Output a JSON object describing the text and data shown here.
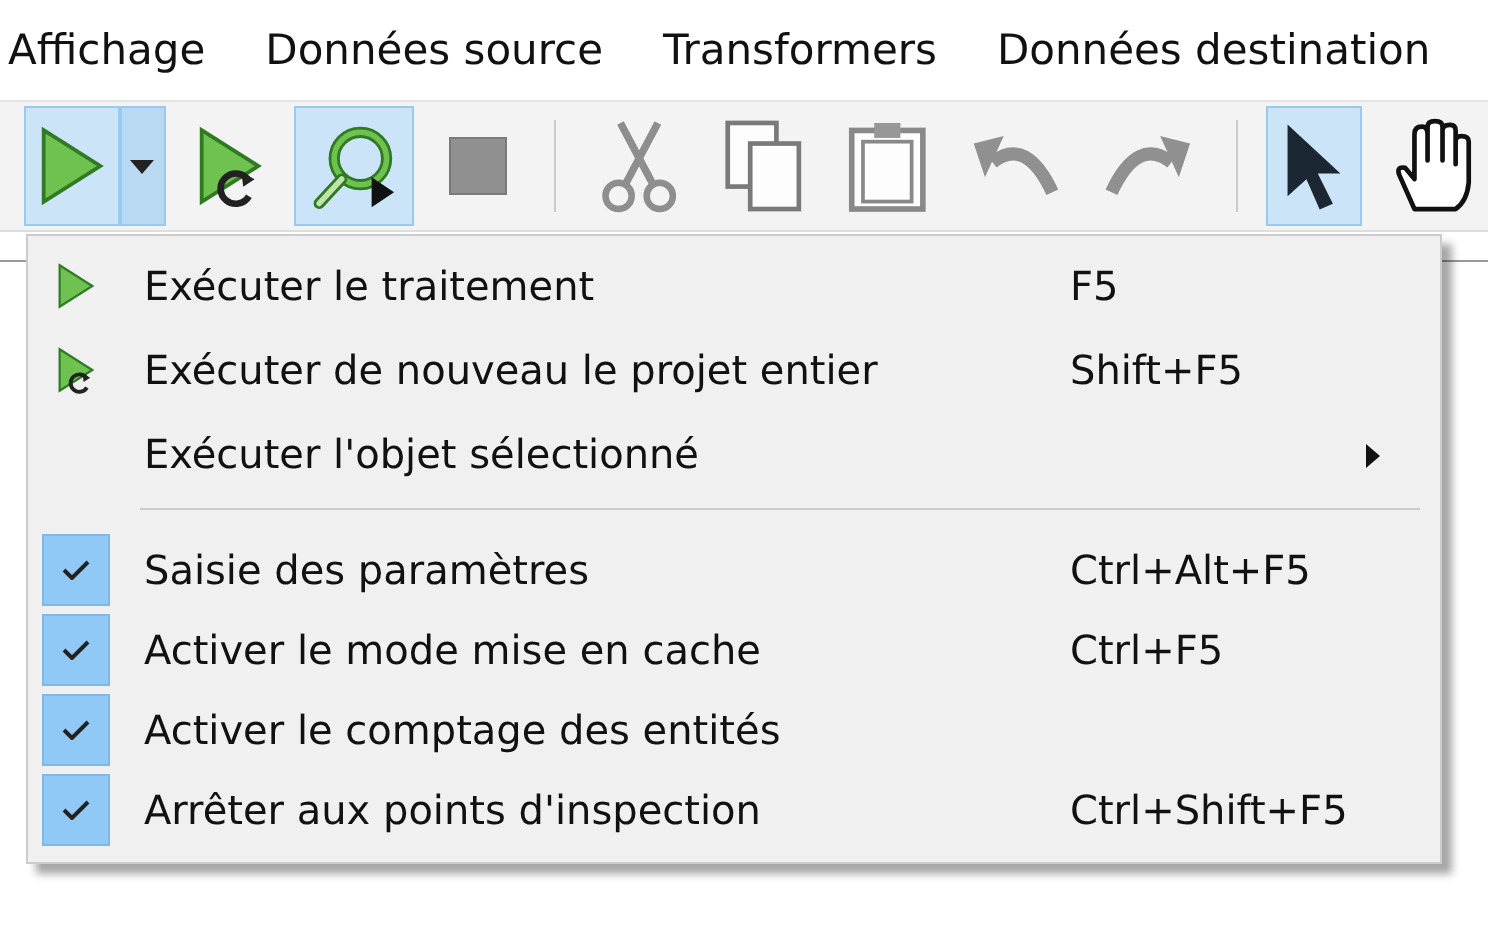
{
  "menubar": [
    {
      "label": "Affichage"
    },
    {
      "label": "Données source"
    },
    {
      "label": "Transformers"
    },
    {
      "label": "Données destination"
    }
  ],
  "toolbar": [
    {
      "kind": "run",
      "selected": true,
      "disabled": false,
      "dropdown": true
    },
    {
      "kind": "rerun",
      "selected": false,
      "disabled": false
    },
    {
      "kind": "inspect",
      "selected": true,
      "disabled": false
    },
    {
      "kind": "stop",
      "selected": false,
      "disabled": true
    },
    {
      "kind": "separator"
    },
    {
      "kind": "cut",
      "selected": false,
      "disabled": true
    },
    {
      "kind": "copy",
      "selected": false,
      "disabled": true
    },
    {
      "kind": "paste",
      "selected": false,
      "disabled": true
    },
    {
      "kind": "undo",
      "selected": false,
      "disabled": true
    },
    {
      "kind": "redo",
      "selected": false,
      "disabled": true
    },
    {
      "kind": "separator"
    },
    {
      "kind": "pointer",
      "selected": true,
      "disabled": false
    },
    {
      "kind": "hand",
      "selected": false,
      "disabled": false
    }
  ],
  "menu": [
    {
      "kind": "run",
      "label": "Exécuter le traitement",
      "shortcut": "F5"
    },
    {
      "kind": "rerun",
      "label": "Exécuter de nouveau le projet entier",
      "shortcut": "Shift+F5"
    },
    {
      "kind": "submenu",
      "label": "Exécuter l'objet sélectionné"
    },
    {
      "kind": "separator"
    },
    {
      "kind": "toggle",
      "checked": true,
      "label": "Saisie des paramètres",
      "shortcut": "Ctrl+Alt+F5"
    },
    {
      "kind": "toggle",
      "checked": true,
      "label": "Activer le mode mise en cache",
      "shortcut": "Ctrl+F5"
    },
    {
      "kind": "toggle",
      "checked": true,
      "label": "Activer le comptage des entités"
    },
    {
      "kind": "toggle",
      "checked": true,
      "label": "Arrêter aux points d'inspection",
      "shortcut": "Ctrl+Shift+F5"
    }
  ]
}
